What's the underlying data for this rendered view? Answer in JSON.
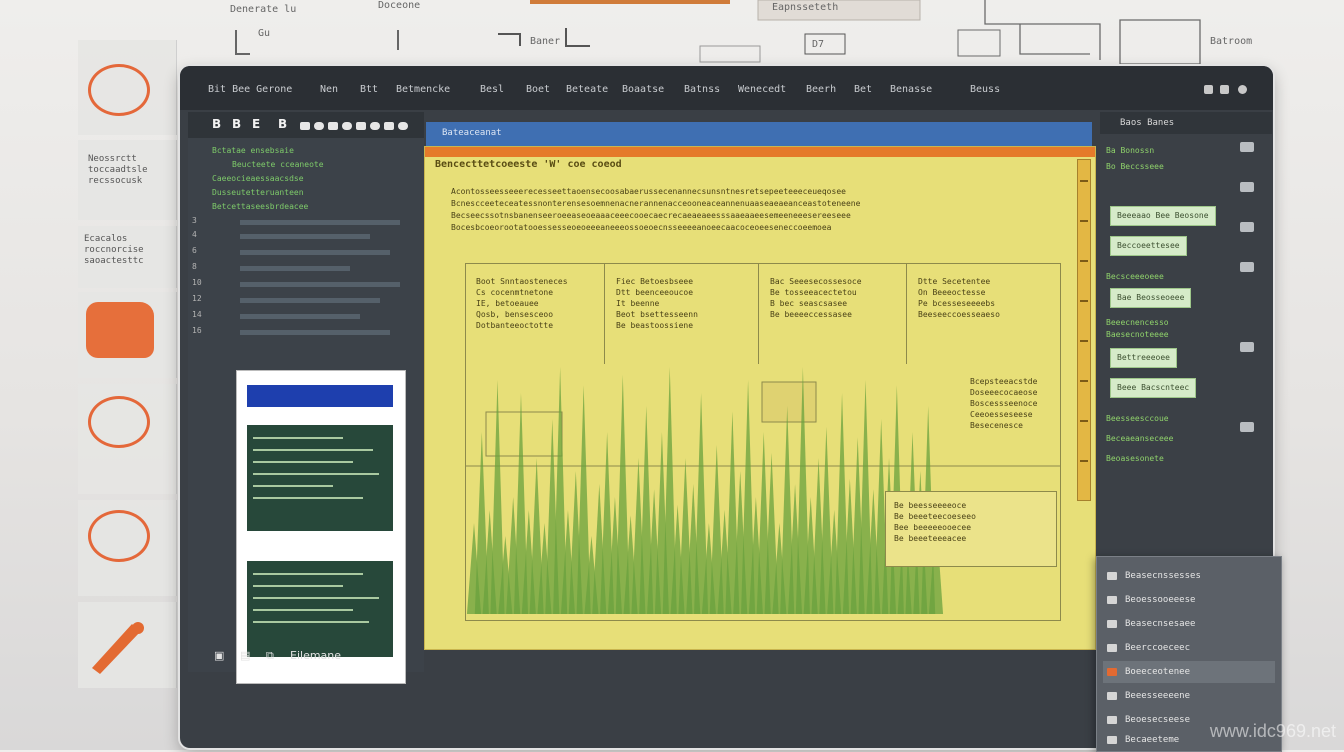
{
  "background": {
    "labels": [
      "Denerate lu",
      "Doceone",
      "Baner",
      "Eapnsseteth",
      "D7",
      "Batroom",
      "Gu"
    ]
  },
  "left_tiles": [
    {
      "text": ""
    },
    {
      "text": "Neossrctt\ntoccaadtsle\nrecssocusk"
    },
    {
      "text": "Ecacalos\nroccnorcise\nsaoactesttc"
    },
    {
      "text": ""
    },
    {
      "text": ""
    },
    {
      "text": ""
    }
  ],
  "topbar": {
    "items": [
      "Bit Bee Gerone",
      "Nen",
      "Btt",
      "Betmencke",
      "Besl",
      "Boet",
      "Beteate",
      "Boaatse",
      "Batnss",
      "Wenecedt",
      "Beerh",
      "Bet",
      "Benasse",
      "Beuss"
    ]
  },
  "left_panel": {
    "toolbar_icons": [
      "B",
      "B",
      "E",
      "B"
    ],
    "code_lines": [
      "Bctatae ensebsaie",
      "Beucteete cceaneote",
      "Caeeocieaessaacsdse",
      "Dusseutetteruanteen",
      "Betcettaseesbrdeacee"
    ],
    "line_numbers": [
      "3",
      "4",
      "6",
      "8",
      "10",
      "12",
      "14",
      "16"
    ]
  },
  "status_bar": {
    "label": "Eilemane"
  },
  "doc_tab": {
    "label": "Bateaceanat"
  },
  "document": {
    "title": "Bencecttetcoeeste 'W' coe coeod",
    "lines": [
      "Acontosseesseeerecesseettaoensecoosabaerussecenannecsunsntnesretsepeeteeeceueqosee",
      "Bcnescceeteceatessnonterensesoemnenacnerannenacceooneaceannenuaaseaeaeanceastoteneene",
      "Becseecssotnsbanenseeroeeaseoeaaaceeecooecaecrecaeaeaeesssaaeaaeesemeeneeesereeseee",
      "Bocesbcoeorootatooessesseoeoeeeaneeeossoeoecnsseeeeanoeecaacoceoeeseneccoeemoea"
    ],
    "columns": [
      "Boot Snntaosteneces\nCs cocenmtnetone\nIE, betoeauee\nQosb, bensesceoo\nDotbanteeoctotte",
      "Fiec Betoesbseee\nDtt beenceeoucoe\nIt beenne\nBeot bsettesseenn\nBe beastoossiene",
      "Bac Seeesecossesoce\nBe tosseeacectetou\nB bec seascsasee\nBe beeeeccessasee",
      "Dtte Secetentee\nOn Beeeoctesse\nPe bcesseseeeebs\nBeeseeccoesseaeso"
    ],
    "right_notes": "Bcepsteeacstde\nDoseeecocaeose\nBoscessseenoce\nCeeoesseseese\nBesecenesce",
    "note_box": "Be beesseeeeoce\nBe beeeteecoeseeo\nBee beeeeeooecee\nBe beeeteeeacee"
  },
  "side_panel": {
    "header": "Baos  Banes",
    "code_lines": [
      "Ba Bonossn",
      "Bo Beccsseee",
      "Becsceeeoeee",
      "Beeecnencesso",
      "Baesecnoteeee",
      "Beesseesccoue",
      "Beceaeanseceee",
      "Beoasesonete"
    ],
    "chips": [
      "Beeeaao Bee Beosone",
      "Beccoeettesee",
      "Bae Beosseoeee",
      "Bettreeeoee",
      "Beee Bacscnteec"
    ]
  },
  "popup_menu": {
    "items": [
      "Beasecnssesses",
      "Beoessooeeese",
      "Beasecnsesaee",
      "Beerccoeceec",
      "Boeeceotenee",
      "Beeesseeeene",
      "Beoesecseese",
      "Becaeeteme"
    ],
    "selected_index": 4
  },
  "chart_data": {
    "type": "area",
    "x": [
      0,
      1,
      2,
      3,
      4,
      5,
      6,
      7,
      8,
      9,
      10,
      11,
      12,
      13,
      14,
      15,
      16,
      17,
      18,
      19,
      20,
      21,
      22,
      23,
      24,
      25,
      26,
      27,
      28,
      29,
      30,
      31,
      32,
      33,
      34,
      35,
      36,
      37,
      38,
      39,
      40,
      41,
      42,
      43,
      44,
      45,
      46,
      47,
      48,
      49,
      50,
      51,
      52,
      53,
      54,
      55,
      56,
      57,
      58,
      59
    ],
    "values": [
      35,
      70,
      40,
      90,
      30,
      45,
      85,
      40,
      60,
      35,
      75,
      95,
      40,
      55,
      88,
      30,
      50,
      70,
      45,
      92,
      38,
      60,
      80,
      48,
      70,
      95,
      42,
      60,
      50,
      85,
      35,
      65,
      40,
      78,
      55,
      90,
      45,
      70,
      62,
      35,
      80,
      50,
      95,
      45,
      60,
      72,
      40,
      85,
      52,
      68,
      90,
      48,
      75,
      60,
      88,
      42,
      70,
      55,
      80,
      38
    ],
    "ylim": [
      0,
      100
    ],
    "color": "#6aa13e"
  },
  "watermark": "www.idc969.net"
}
